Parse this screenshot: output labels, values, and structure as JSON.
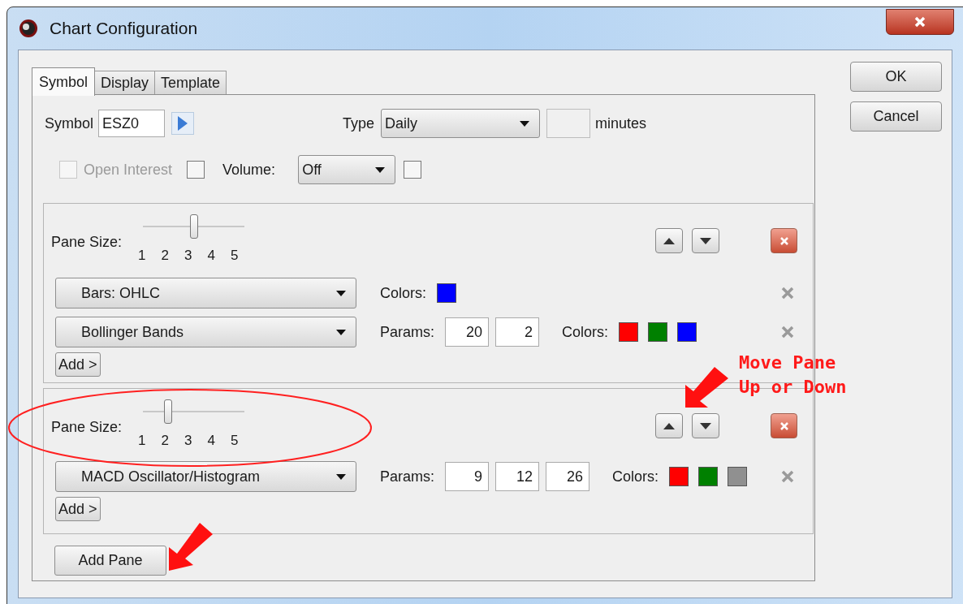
{
  "window": {
    "title": "Chart Configuration"
  },
  "tabs": [
    {
      "label": "Symbol",
      "selected": true
    },
    {
      "label": "Display",
      "selected": false
    },
    {
      "label": "Template",
      "selected": false
    }
  ],
  "symbol": {
    "label": "Symbol",
    "value": "ESZ0"
  },
  "type": {
    "label": "Type",
    "value": "Daily",
    "unit": "minutes"
  },
  "open_interest": {
    "label": "Open Interest",
    "checked": false,
    "disabled": true,
    "extra_checked": false
  },
  "volume": {
    "label": "Volume:",
    "value": "Off",
    "checked": false
  },
  "panes": [
    {
      "size_label": "Pane Size:",
      "ticks": [
        "1",
        "2",
        "3",
        "4",
        "5"
      ],
      "level": 0.5,
      "add_label": "Add >",
      "studies": [
        {
          "name": "Bars: OHLC",
          "colors_label": "Colors:",
          "colors": [
            {
              "color": "#0000ff"
            }
          ]
        },
        {
          "name": "Bollinger Bands",
          "params_label": "Params:",
          "params": [
            "20",
            "2"
          ],
          "colors_label": "Colors:",
          "colors": [
            {
              "color": "#ff0000"
            },
            {
              "color": "#008000"
            },
            {
              "color": "#0000ff"
            }
          ]
        }
      ]
    },
    {
      "size_label": "Pane Size:",
      "ticks": [
        "1",
        "2",
        "3",
        "4",
        "5"
      ],
      "level": 0.25,
      "add_label": "Add >",
      "studies": [
        {
          "name": "MACD Oscillator/Histogram",
          "params_label": "Params:",
          "params": [
            "9",
            "12",
            "26"
          ],
          "colors_label": "Colors:",
          "colors": [
            {
              "color": "#ff0000"
            },
            {
              "color": "#008000"
            },
            {
              "color": "#909090"
            }
          ]
        }
      ]
    }
  ],
  "add_pane": "Add Pane",
  "buttons": [
    "OK",
    "Cancel"
  ],
  "annotation": {
    "text": "Move Pane\nUp or Down"
  }
}
